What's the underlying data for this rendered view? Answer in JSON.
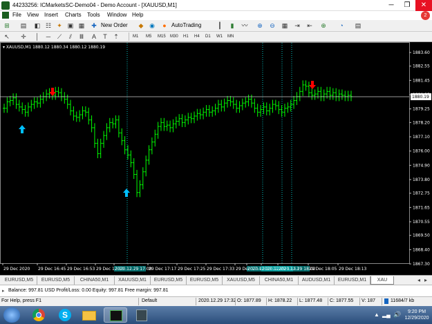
{
  "window": {
    "title": "44233256: ICMarketsSC-Demo04 - Demo Account - [XAUUSD,M1]",
    "notify_count": "2"
  },
  "menu": [
    "File",
    "View",
    "Insert",
    "Charts",
    "Tools",
    "Window",
    "Help"
  ],
  "toolbar": {
    "new_order": "New Order",
    "autotrading": "AutoTrading"
  },
  "timeframes": [
    "M1",
    "M5",
    "M15",
    "M30",
    "H1",
    "H4",
    "D1",
    "W1",
    "MN"
  ],
  "chart": {
    "header": "XAUUSD,M1  1880.12 1880.34 1880.12 1880.19",
    "current_price": "1880.19",
    "y_ticks": [
      "1883.60",
      "1882.55",
      "1881.45",
      "1880.35",
      "1879.25",
      "1878.20",
      "1877.10",
      "1876.00",
      "1874.90",
      "1873.80",
      "1872.75",
      "1871.65",
      "1870.55",
      "1869.50",
      "1868.40",
      "1867.30"
    ],
    "x_ticks": [
      "29 Dec 2020",
      "29 Dec 16:45",
      "29 Dec 16:53",
      "29 Dec 17:01",
      "2020.12.29 17:08",
      "29 Dec 17:17",
      "29 Dec 17:25",
      "29 Dec 17:33",
      "29 Dec 17:41",
      "2020.12.29 17:45",
      "2020.12.29 17:53",
      "2020.12.29 18:02",
      "29 Dec 18:05",
      "29 Dec 18:13"
    ]
  },
  "tabs": [
    "EURUSD,M5",
    "EURUSD,M5",
    "CHINA50,M1",
    "XAUUSD,M1",
    "EURUSD,M5",
    "EURUSD,M5",
    "XAUUSD,M5",
    "CHINA50,M1",
    "AUDUSD,M1",
    "EURUSD,M1",
    "XAU"
  ],
  "terminal": {
    "balance": "Balance: 997.81 USD  Profit/Loss: 0.00  Equity: 997.81  Free margin: 997.81"
  },
  "status": {
    "help": "For Help, press F1",
    "profile": "Default",
    "datetime": "2020.12.29 17:32",
    "open": "O: 1877.89",
    "high": "H: 1878.22",
    "low": "L: 1877.48",
    "close": "C: 1877.55",
    "volume": "V: 187",
    "traffic": "11684/7 kb"
  },
  "clock": {
    "time": "9:20 PM",
    "date": "12/29/2020"
  },
  "colors": {
    "bull": "#00ff00",
    "arrow_up": "#00bfff",
    "arrow_down": "#ff0000",
    "vline": "#00c0c0"
  }
}
